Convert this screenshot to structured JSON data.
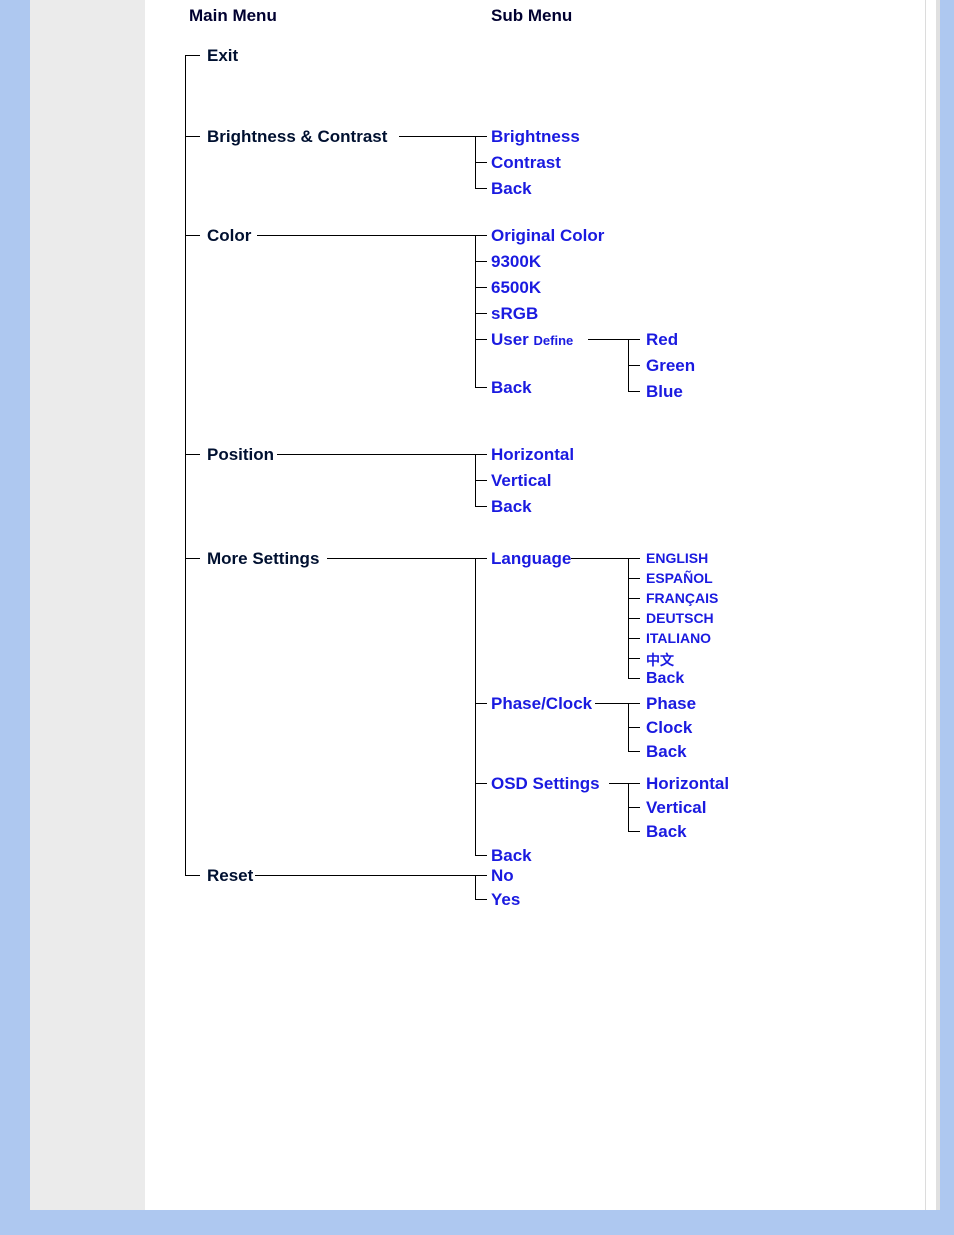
{
  "headers": {
    "main": "Main Menu",
    "sub": "Sub Menu"
  },
  "main": {
    "exit": "Exit",
    "bc": "Brightness & Contrast",
    "color": "Color",
    "position": "Position",
    "more": "More Settings",
    "reset": "Reset"
  },
  "bc_sub": {
    "brightness": "Brightness",
    "contrast": "Contrast",
    "back": "Back"
  },
  "color_sub": {
    "orig": "Original Color",
    "k93": "9300K",
    "k65": "6500K",
    "srgb": "sRGB",
    "user": "User",
    "define": "Define",
    "back": "Back"
  },
  "user_sub": {
    "red": "Red",
    "green": "Green",
    "blue": "Blue"
  },
  "pos_sub": {
    "h": "Horizontal",
    "v": "Vertical",
    "back": "Back"
  },
  "more_sub": {
    "lang": "Language",
    "phase": "Phase/Clock",
    "osd": "OSD Settings",
    "back": "Back"
  },
  "lang_sub": {
    "en": "ENGLISH",
    "es": "ESPAÑOL",
    "fr": "FRANÇAIS",
    "de": "DEUTSCH",
    "it": "ITALIANO",
    "zh": "中文",
    "back": "Back"
  },
  "phase_sub": {
    "phase": "Phase",
    "clock": "Clock",
    "back": "Back"
  },
  "osd_sub": {
    "h": "Horizontal",
    "v": "Vertical",
    "back": "Back"
  },
  "reset_sub": {
    "no": "No",
    "yes": "Yes"
  }
}
